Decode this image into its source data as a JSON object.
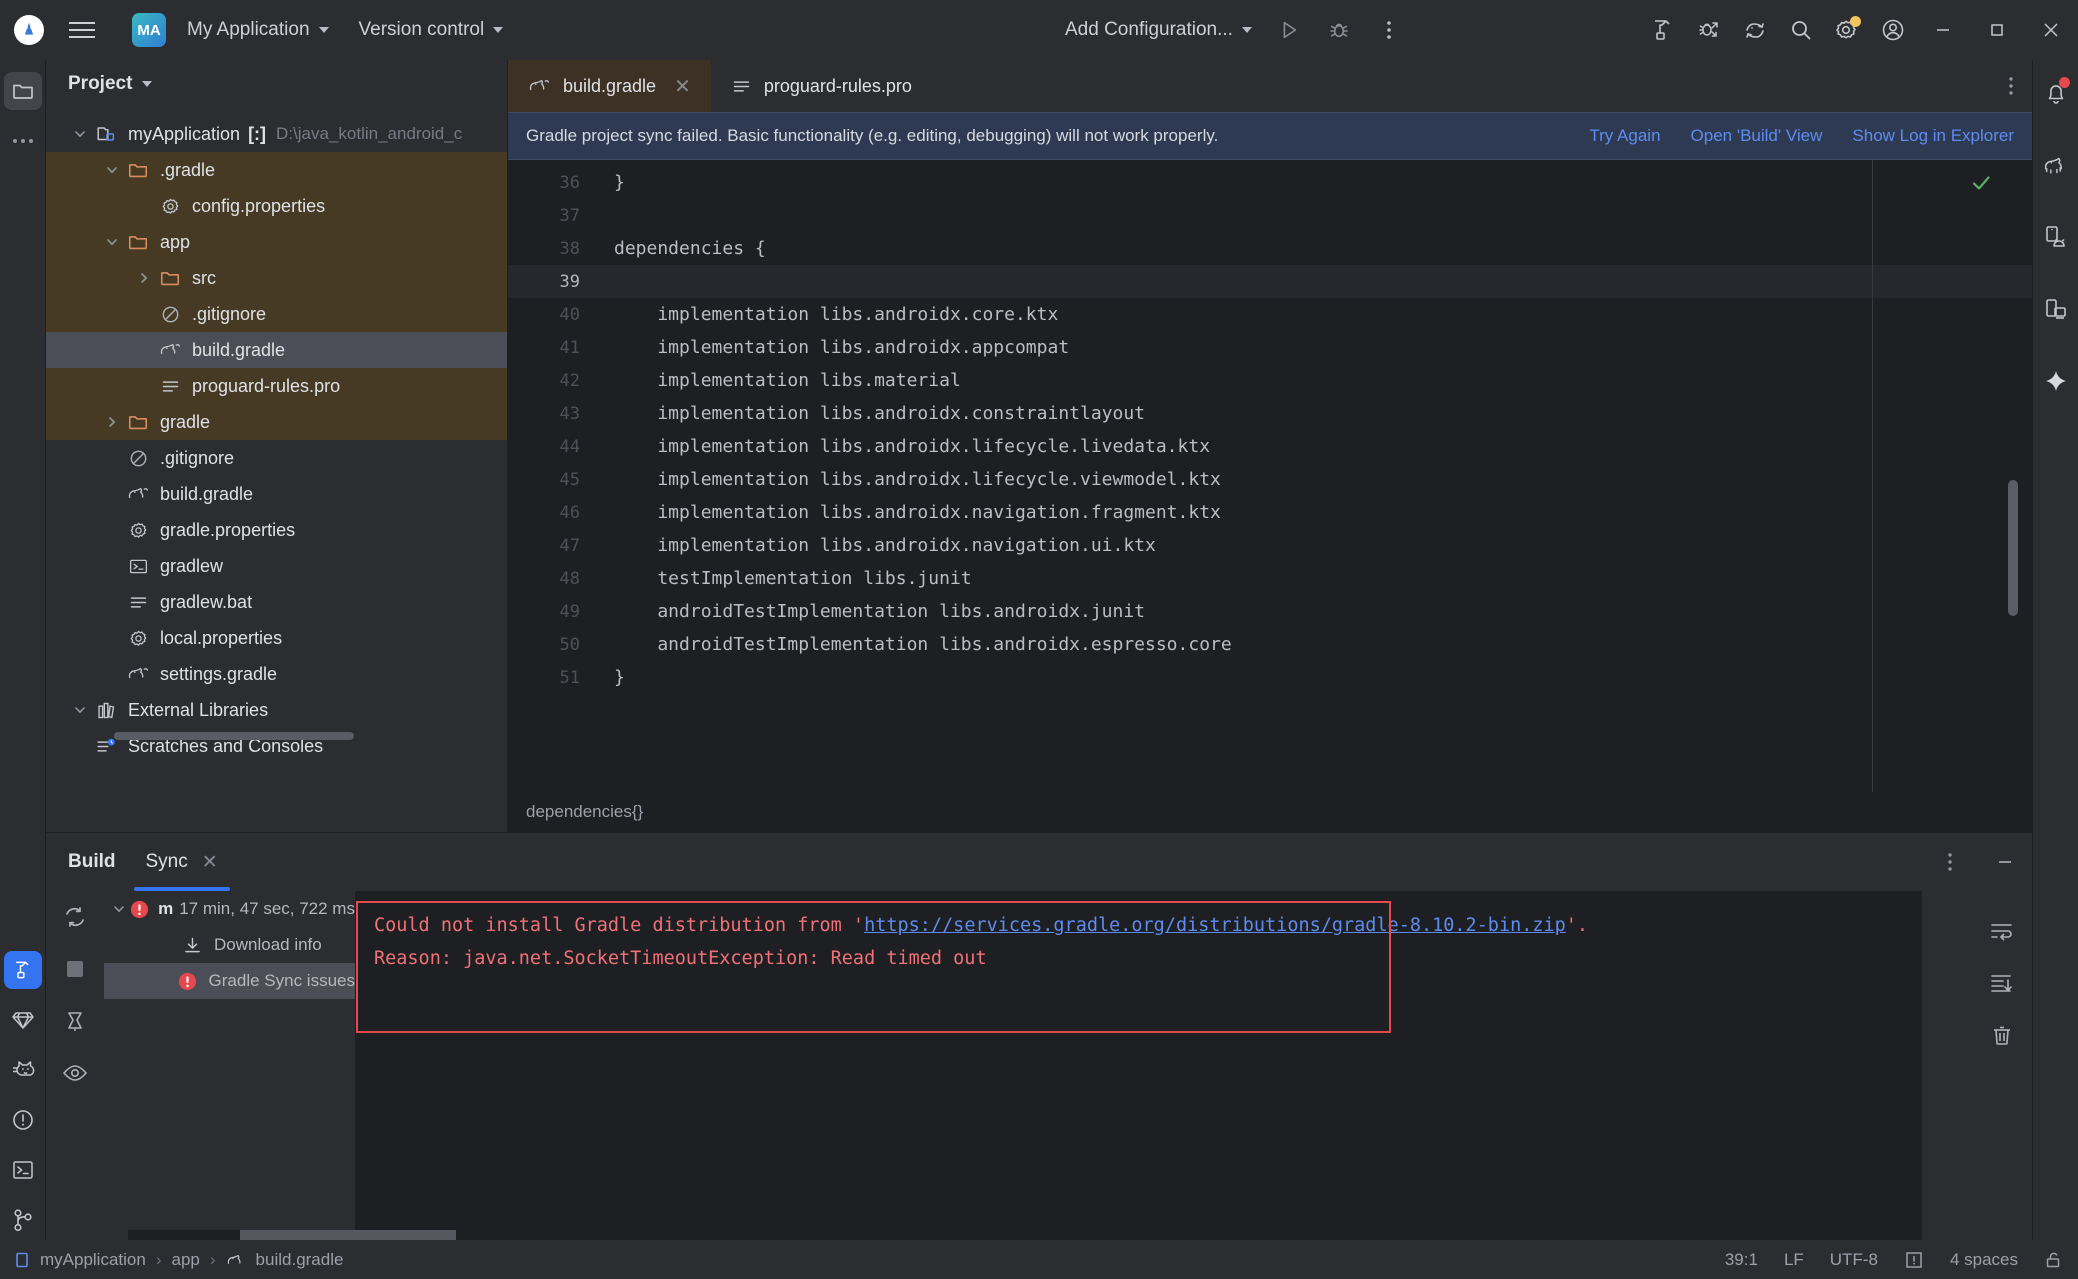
{
  "titlebar": {
    "logo_icon": "android-studio-logo-icon",
    "menu_icon": "hamburger-menu-icon",
    "project_badge": "MA",
    "project_name": "My Application",
    "version_control": "Version control",
    "run_config": "Add Configuration...",
    "icons": {
      "run": "run-icon",
      "debug": "debug-icon",
      "more": "more-vertical-icon",
      "build": "build-hammer-icon",
      "debug_attach": "attach-debugger-icon",
      "device_streaming": "device-streaming-icon",
      "search": "search-icon",
      "settings": "gear-icon",
      "account": "account-icon",
      "minimize": "minimize-icon",
      "maximize": "maximize-icon",
      "close": "close-icon"
    },
    "settings_badge_color": "#f2c55c"
  },
  "left_rail": {
    "items": [
      {
        "name": "project-tool-window",
        "icon": "folder-icon",
        "active": true
      },
      {
        "name": "more-tool-windows",
        "icon": "ellipsis-icon",
        "active": false
      }
    ],
    "bottom_items": [
      {
        "name": "build-tool-window",
        "icon": "hammer-icon",
        "active": true
      },
      {
        "name": "gradle-tool-window",
        "icon": "gem-icon",
        "active": false
      },
      {
        "name": "logcat-tool-window",
        "icon": "cat-icon",
        "active": false
      },
      {
        "name": "problems-tool-window",
        "icon": "exclamation-circle-icon",
        "active": false
      },
      {
        "name": "terminal-tool-window",
        "icon": "terminal-icon",
        "active": false
      },
      {
        "name": "version-control-tool-window",
        "icon": "git-branch-icon",
        "active": false
      }
    ]
  },
  "right_rail": {
    "items": [
      {
        "name": "notifications",
        "icon": "bell-icon",
        "badge": true
      },
      {
        "name": "gradle",
        "icon": "gradle-elephant-icon",
        "badge": false
      },
      {
        "name": "device-manager",
        "icon": "device-manager-icon",
        "badge": false
      },
      {
        "name": "running-devices",
        "icon": "running-devices-icon",
        "badge": false
      },
      {
        "name": "gemini",
        "icon": "sparkle-icon",
        "badge": false
      }
    ]
  },
  "project_panel": {
    "title": "Project",
    "tree": [
      {
        "depth": 0,
        "arrow": "down",
        "icon": "module-icon",
        "label": "myApplication",
        "brackets": "[:]",
        "path": "D:\\java_kotlin_android_c",
        "scope": false,
        "selected": false
      },
      {
        "depth": 1,
        "arrow": "down",
        "icon": "folder-icon",
        "label": ".gradle",
        "scope": true,
        "selected": false
      },
      {
        "depth": 2,
        "arrow": "none",
        "icon": "properties-icon",
        "label": "config.properties",
        "scope": true,
        "selected": false
      },
      {
        "depth": 1,
        "arrow": "down",
        "icon": "folder-icon",
        "label": "app",
        "scope": true,
        "selected": false
      },
      {
        "depth": 2,
        "arrow": "right",
        "icon": "folder-icon",
        "label": "src",
        "scope": true,
        "selected": false
      },
      {
        "depth": 2,
        "arrow": "none",
        "icon": "gitignore-icon",
        "label": ".gitignore",
        "scope": true,
        "selected": false
      },
      {
        "depth": 2,
        "arrow": "none",
        "icon": "gradle-file-icon",
        "label": "build.gradle",
        "scope": true,
        "selected": true
      },
      {
        "depth": 2,
        "arrow": "none",
        "icon": "text-file-icon",
        "label": "proguard-rules.pro",
        "scope": true,
        "selected": false
      },
      {
        "depth": 1,
        "arrow": "right",
        "icon": "folder-icon",
        "label": "gradle",
        "scope": true,
        "selected": false
      },
      {
        "depth": 1,
        "arrow": "none",
        "icon": "gitignore-icon",
        "label": ".gitignore",
        "scope": false,
        "selected": false
      },
      {
        "depth": 1,
        "arrow": "none",
        "icon": "gradle-file-icon",
        "label": "build.gradle",
        "scope": false,
        "selected": false
      },
      {
        "depth": 1,
        "arrow": "none",
        "icon": "properties-icon",
        "label": "gradle.properties",
        "scope": false,
        "selected": false
      },
      {
        "depth": 1,
        "arrow": "none",
        "icon": "shell-icon",
        "label": "gradlew",
        "scope": false,
        "selected": false
      },
      {
        "depth": 1,
        "arrow": "none",
        "icon": "text-file-icon",
        "label": "gradlew.bat",
        "scope": false,
        "selected": false
      },
      {
        "depth": 1,
        "arrow": "none",
        "icon": "properties-icon",
        "label": "local.properties",
        "scope": false,
        "selected": false
      },
      {
        "depth": 1,
        "arrow": "none",
        "icon": "gradle-file-icon",
        "label": "settings.gradle",
        "scope": false,
        "selected": false
      },
      {
        "depth": 0,
        "arrow": "down",
        "icon": "libraries-icon",
        "label": "External Libraries",
        "scope": false,
        "selected": false
      },
      {
        "depth": 0,
        "arrow": "none",
        "icon": "scratches-icon",
        "label": "Scratches and Consoles",
        "scope": false,
        "selected": false
      }
    ]
  },
  "editor": {
    "tabs": [
      {
        "label": "build.gradle",
        "icon": "gradle-file-icon",
        "active": true,
        "closable": true
      },
      {
        "label": "proguard-rules.pro",
        "icon": "text-file-icon",
        "active": false,
        "closable": false
      }
    ],
    "tab_options_icon": "more-vertical-icon",
    "notification": {
      "message": "Gradle project sync failed. Basic functionality (e.g. editing, debugging) will not work properly.",
      "links": [
        "Try Again",
        "Open 'Build' View",
        "Show Log in Explorer"
      ],
      "background": "#2e3a52"
    },
    "lines": [
      {
        "n": "36",
        "text": "}",
        "current": false
      },
      {
        "n": "37",
        "text": "",
        "current": false
      },
      {
        "n": "38",
        "text": "dependencies {",
        "current": false
      },
      {
        "n": "39",
        "text": "",
        "current": true
      },
      {
        "n": "40",
        "text": "    implementation libs.androidx.core.ktx",
        "current": false
      },
      {
        "n": "41",
        "text": "    implementation libs.androidx.appcompat",
        "current": false
      },
      {
        "n": "42",
        "text": "    implementation libs.material",
        "current": false
      },
      {
        "n": "43",
        "text": "    implementation libs.androidx.constraintlayout",
        "current": false
      },
      {
        "n": "44",
        "text": "    implementation libs.androidx.lifecycle.livedata.ktx",
        "current": false
      },
      {
        "n": "45",
        "text": "    implementation libs.androidx.lifecycle.viewmodel.ktx",
        "current": false
      },
      {
        "n": "46",
        "text": "    implementation libs.androidx.navigation.fragment.ktx",
        "current": false
      },
      {
        "n": "47",
        "text": "    implementation libs.androidx.navigation.ui.ktx",
        "current": false
      },
      {
        "n": "48",
        "text": "    testImplementation libs.junit",
        "current": false
      },
      {
        "n": "49",
        "text": "    androidTestImplementation libs.androidx.junit",
        "current": false
      },
      {
        "n": "50",
        "text": "    androidTestImplementation libs.androidx.espresso.core",
        "current": false
      },
      {
        "n": "51",
        "text": "}",
        "current": false
      }
    ],
    "breadcrumb": "dependencies{}",
    "inspection_icon": "checkmark-ok-icon"
  },
  "build_panel": {
    "tabs": [
      {
        "label": "Build",
        "active": false,
        "bold": true,
        "closable": false
      },
      {
        "label": "Sync",
        "active": true,
        "bold": false,
        "closable": true,
        "close_icon": "close-icon"
      }
    ],
    "tools": [
      {
        "name": "restart-sync-button",
        "icon": "refresh-icon"
      },
      {
        "name": "stop-button",
        "icon": "stop-square-icon"
      },
      {
        "name": "pin-button",
        "icon": "pin-icon"
      },
      {
        "name": "toggle-view-button",
        "icon": "eye-icon"
      }
    ],
    "tree": [
      {
        "label": "17 min, 47 sec, 722 ms",
        "prefix": "m",
        "icon": "error-icon",
        "arrow": "down",
        "depth": 0,
        "selected": false
      },
      {
        "label": "Download info",
        "icon": "download-icon",
        "arrow": "none",
        "depth": 1,
        "selected": false
      },
      {
        "label": "Gradle Sync issues",
        "icon": "error-icon",
        "arrow": "none",
        "depth": 1,
        "selected": true
      }
    ],
    "console": {
      "line1_pre": "Could not install Gradle distribution from '",
      "line1_link": "https://services.gradle.org/distributions/gradle-8.10.2-bin.zip",
      "line1_post": "'.",
      "line2": "Reason: java.net.SocketTimeoutException: Read timed out",
      "highlight_color": "#e5484d",
      "text_color": "#f07178"
    },
    "header_actions": [
      {
        "name": "build-panel-options",
        "icon": "more-vertical-icon"
      },
      {
        "name": "build-panel-minimize",
        "icon": "minimize-icon"
      }
    ],
    "side_actions": [
      {
        "name": "soft-wrap-button",
        "icon": "soft-wrap-icon"
      },
      {
        "name": "scroll-to-end-button",
        "icon": "scroll-to-end-icon"
      },
      {
        "name": "clear-all-button",
        "icon": "trash-icon"
      }
    ]
  },
  "status_bar": {
    "breadcrumb": [
      {
        "label": "myApplication",
        "icon": "module-icon"
      },
      {
        "label": "app",
        "icon": "none"
      },
      {
        "label": "build.gradle",
        "icon": "gradle-file-icon"
      }
    ],
    "separator": "›",
    "right": {
      "caret": "39:1",
      "line_separator": "LF",
      "encoding": "UTF-8",
      "indent": "4 spaces",
      "inspection_icon": "inspections-icon",
      "lock_icon": "lock-icon"
    }
  }
}
